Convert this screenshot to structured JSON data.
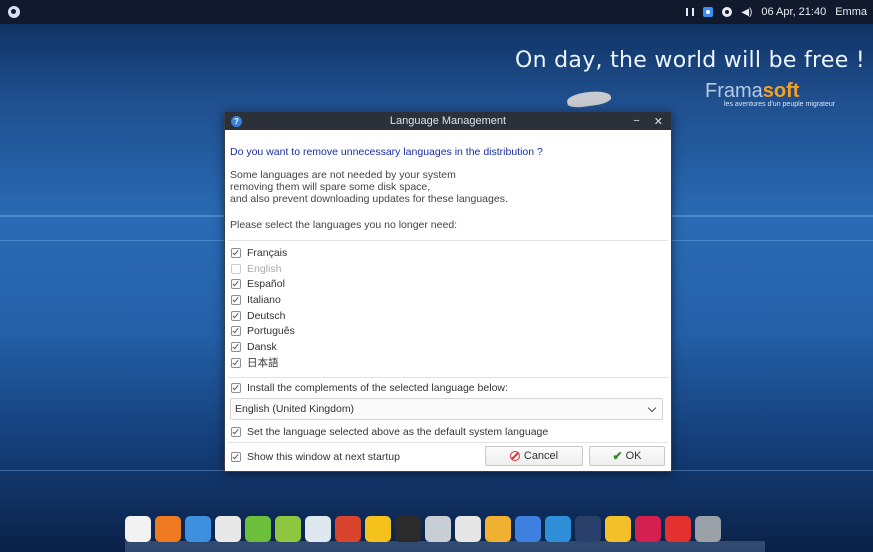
{
  "topbar": {
    "datetime": "06 Apr, 21:40",
    "user": "Emma",
    "icons": [
      "network-icon",
      "update-icon",
      "settings-icon",
      "volume-icon"
    ]
  },
  "wallpaper": {
    "slogan": "On day, the world will be free !",
    "brand_a": "Frama",
    "brand_b": "soft",
    "brand_sub": "les aventures d'un peuple migrateur"
  },
  "dialog": {
    "title": "Language Management",
    "question": "Do you want to remove unnecessary languages in the distribution ?",
    "desc": [
      "Some languages are not needed by your system",
      "removing them will spare some disk space,",
      "and also prevent downloading updates for these languages."
    ],
    "prompt": "Please select the languages you no longer need:",
    "languages": [
      {
        "label": "Français",
        "checked": true,
        "disabled": false
      },
      {
        "label": "English",
        "checked": false,
        "disabled": true
      },
      {
        "label": "Español",
        "checked": true,
        "disabled": false
      },
      {
        "label": "Italiano",
        "checked": true,
        "disabled": false
      },
      {
        "label": "Deutsch",
        "checked": true,
        "disabled": false
      },
      {
        "label": "Português",
        "checked": true,
        "disabled": false
      },
      {
        "label": "Dansk",
        "checked": true,
        "disabled": false
      },
      {
        "label": "日本語",
        "checked": true,
        "disabled": false
      }
    ],
    "install_complements": {
      "label": "Install the complements of the selected language below:",
      "checked": true
    },
    "selected_language": "English (United Kingdom)",
    "set_default": {
      "label": "Set the language selected above as the default system language",
      "checked": true
    },
    "show_at_startup": {
      "label": "Show this window at next startup",
      "checked": true
    },
    "cancel_label": "Cancel",
    "ok_label": "OK"
  },
  "dock": {
    "items": [
      {
        "name": "home-icon",
        "color": "#f2f2f2"
      },
      {
        "name": "firefox-icon",
        "color": "#f07a22"
      },
      {
        "name": "globe-icon",
        "color": "#3d8fe0"
      },
      {
        "name": "document-icon",
        "color": "#e8e8e8"
      },
      {
        "name": "film-editor-icon",
        "color": "#6bbf3a"
      },
      {
        "name": "clapper-icon",
        "color": "#8ec63f"
      },
      {
        "name": "image-viewer-icon",
        "color": "#dfe7f0"
      },
      {
        "name": "media-player-icon",
        "color": "#d9452c"
      },
      {
        "name": "star-icon",
        "color": "#f5c21b"
      },
      {
        "name": "tux-icon",
        "color": "#2b2b2b"
      },
      {
        "name": "gears-icon",
        "color": "#c8ced6"
      },
      {
        "name": "house-settings-icon",
        "color": "#e6e6e6"
      },
      {
        "name": "atom-icon",
        "color": "#f0b030"
      },
      {
        "name": "help-icon",
        "color": "#3e7fe0"
      },
      {
        "name": "workspace-switcher-icon",
        "color": "#2f8fd8"
      },
      {
        "name": "window-manager-icon",
        "color": "#2a3f6a"
      },
      {
        "name": "notes-icon",
        "color": "#f4c02a"
      },
      {
        "name": "debian-icon",
        "color": "#d3204f"
      },
      {
        "name": "power-icon",
        "color": "#e53030"
      },
      {
        "name": "trash-icon",
        "color": "#9aa0a8"
      }
    ]
  }
}
